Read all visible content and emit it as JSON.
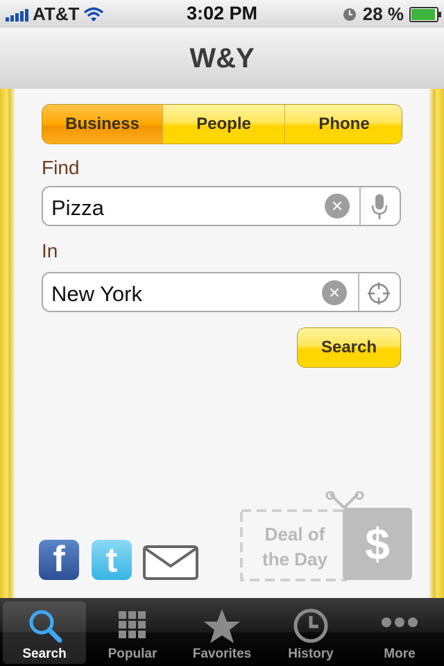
{
  "status_bar": {
    "carrier": "AT&T",
    "time": "3:02 PM",
    "battery": "28 %",
    "battery_level": 0.28
  },
  "nav": {
    "title": "W&Y"
  },
  "search_type": {
    "tabs": [
      "Business",
      "People",
      "Phone"
    ],
    "selected": "Business"
  },
  "find": {
    "label": "Find",
    "value": "Pizza"
  },
  "location": {
    "label": "In",
    "value": "New York"
  },
  "search_button": "Search",
  "deal": {
    "line1": "Deal of",
    "line2": "the Day",
    "symbol": "$"
  },
  "social": {
    "facebook_glyph": "f",
    "twitter_glyph": "t"
  },
  "tab_bar": {
    "items": [
      "Search",
      "Popular",
      "Favorites",
      "History",
      "More"
    ],
    "active": "Search"
  },
  "colors": {
    "accent_yellow": "#ffd400",
    "active_orange": "#ffa800",
    "label_brown": "#6b3c1e"
  }
}
